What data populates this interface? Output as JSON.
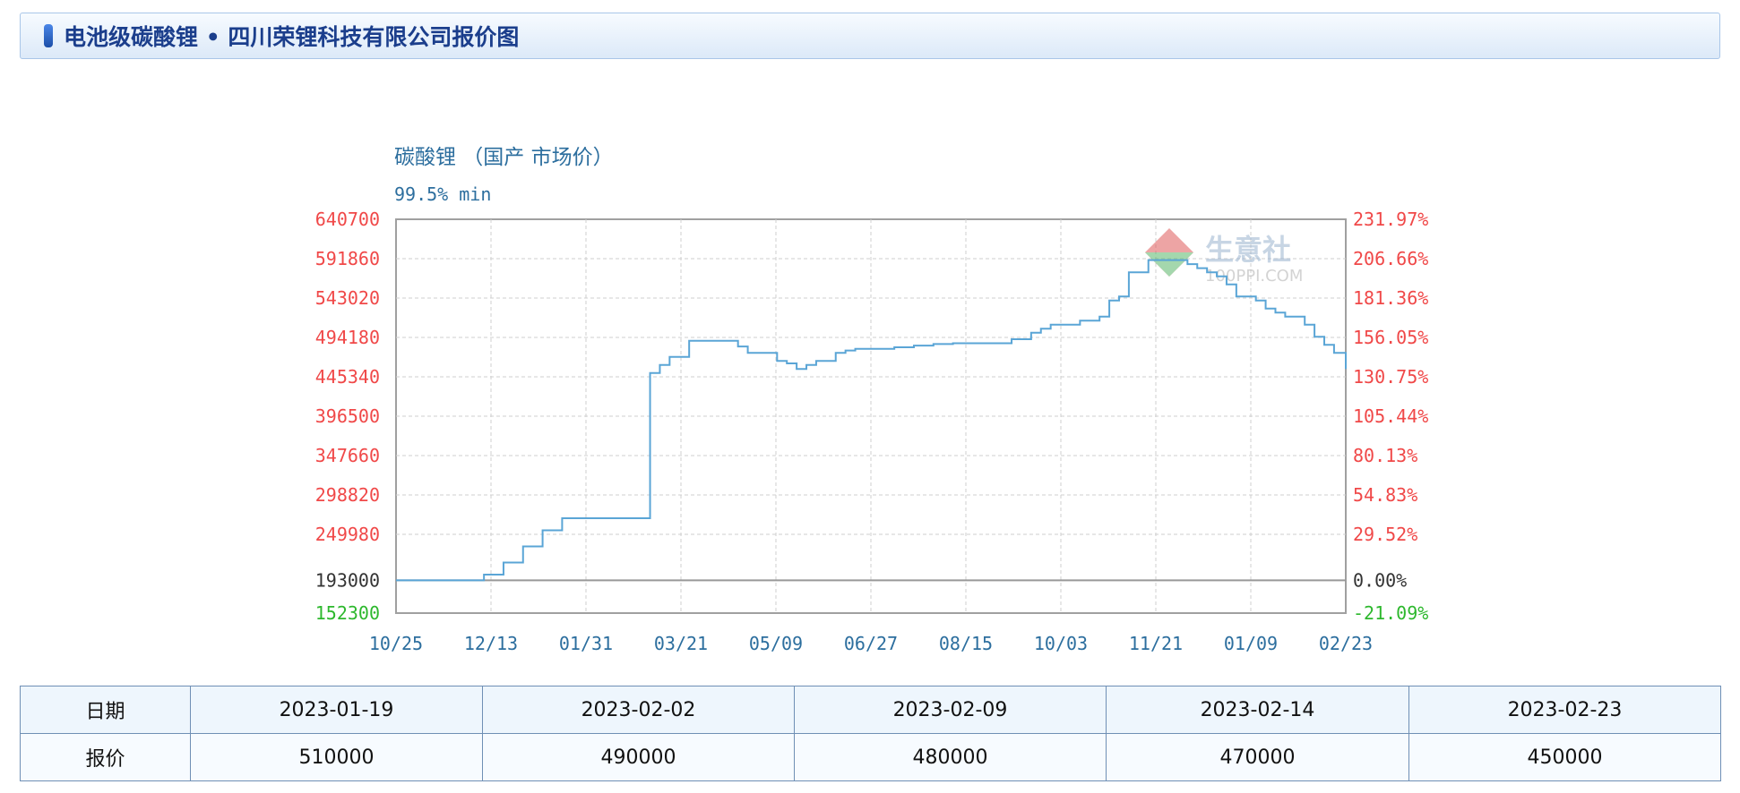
{
  "header": {
    "title": "电池级碳酸锂 • 四川荣锂科技有限公司报价图"
  },
  "chart_data": {
    "type": "line",
    "title": "碳酸锂 （国产 市场价）",
    "subtitle": "99.5% min",
    "x_ticks": [
      "10/25",
      "12/13",
      "01/31",
      "03/21",
      "05/09",
      "06/27",
      "08/15",
      "10/03",
      "11/21",
      "01/09",
      "02/23"
    ],
    "y_left_ticks": [
      "640700",
      "591860",
      "543020",
      "494180",
      "445340",
      "396500",
      "347660",
      "298820",
      "249980",
      "193000",
      "152300"
    ],
    "y_right_ticks": [
      "231.97%",
      "206.66%",
      "181.36%",
      "156.05%",
      "130.75%",
      "105.44%",
      "80.13%",
      "54.83%",
      "29.52%",
      "0.00%",
      "-21.09%"
    ],
    "baseline": 193000,
    "ylim": [
      152300,
      640700
    ],
    "xlim": [
      0,
      486
    ],
    "watermark": {
      "name": "生意社",
      "url": "100PPI.COM"
    },
    "series": [
      {
        "color": "#5aa5d6",
        "x": [
          0,
          30,
          45,
          55,
          60,
          65,
          70,
          75,
          85,
          90,
          100,
          115,
          125,
          130,
          135,
          140,
          150,
          160,
          170,
          175,
          180,
          185,
          190,
          195,
          200,
          205,
          210,
          215,
          220,
          225,
          230,
          235,
          245,
          255,
          265,
          275,
          285,
          295,
          305,
          315,
          325,
          330,
          335,
          340,
          350,
          355,
          360,
          365,
          370,
          375,
          380,
          385,
          390,
          400,
          405,
          410,
          415,
          420,
          425,
          430,
          440,
          445,
          450,
          455,
          460,
          465,
          470,
          475,
          480,
          486
        ],
        "values": [
          193000,
          193000,
          200000,
          215000,
          215000,
          235000,
          235000,
          255000,
          270000,
          270000,
          270000,
          270000,
          270000,
          450000,
          460000,
          470000,
          490000,
          490000,
          490000,
          483000,
          475000,
          475000,
          475000,
          465000,
          462000,
          455000,
          460000,
          465000,
          465000,
          475000,
          478000,
          480000,
          480000,
          482000,
          484000,
          486000,
          487000,
          487000,
          487000,
          492000,
          500000,
          505000,
          510000,
          510000,
          515000,
          515000,
          520000,
          540000,
          545000,
          575000,
          575000,
          590000,
          590000,
          590000,
          585000,
          580000,
          575000,
          570000,
          560000,
          545000,
          540000,
          530000,
          525000,
          520000,
          520000,
          510000,
          495000,
          485000,
          475000,
          455000
        ]
      }
    ]
  },
  "table": {
    "row_date": {
      "label": "日期",
      "values": [
        "2023-01-19",
        "2023-02-02",
        "2023-02-09",
        "2023-02-14",
        "2023-02-23"
      ]
    },
    "row_price": {
      "label": "报价",
      "values": [
        "510000",
        "490000",
        "480000",
        "470000",
        "450000"
      ]
    }
  }
}
